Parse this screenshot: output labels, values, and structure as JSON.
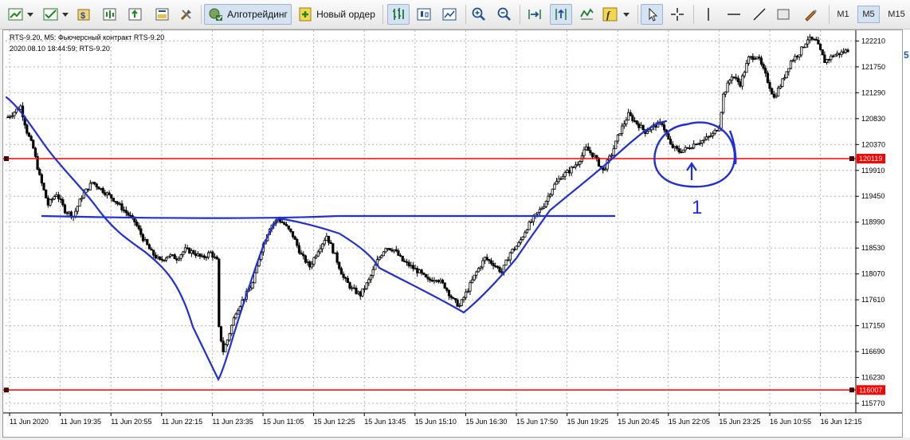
{
  "toolbar": {
    "algo_trading_label": "Алготрейдинг",
    "new_order_label": "Новый ордер",
    "timeframes": [
      {
        "label": "M1",
        "active": false
      },
      {
        "label": "M5",
        "active": true
      },
      {
        "label": "M15",
        "active": false
      }
    ]
  },
  "chart": {
    "header_title": "RTS-9.20, M5:  Фьючерсный контракт RTS-9.20",
    "header_info": "2020.08.10 18:44:59; RTS-9.20",
    "price_axis_labels": [
      "122210",
      "121750",
      "121290",
      "120830",
      "120370",
      "119910",
      "119450",
      "118990",
      "118530",
      "118070",
      "117610",
      "117150",
      "116690",
      "116230",
      "115770"
    ],
    "time_axis_labels": [
      "11 Jun 2020",
      "11 Jun 19:35",
      "11 Jun 20:55",
      "11 Jun 22:15",
      "11 Jun 23:35",
      "15 Jun 11:05",
      "15 Jun 12:25",
      "15 Jun 13:45",
      "15 Jun 15:10",
      "15 Jun 16:30",
      "15 Jun 17:50",
      "15 Jun 19:25",
      "15 Jun 20:45",
      "15 Jun 22:05",
      "15 Jun 23:25",
      "16 Jun 10:55",
      "16 Jun 12:15"
    ],
    "horizontal_levels": [
      {
        "price": 120119,
        "label": "120119",
        "color": "#ff0000"
      },
      {
        "price": 116007,
        "label": "116007",
        "color": "#ff0000"
      }
    ],
    "annotation_text": "1",
    "edge_label": "5",
    "colors": {
      "candle": "#000000",
      "drawing": "#1f2fd9",
      "level": "#ff0000",
      "grid": "#b4b4b4"
    }
  },
  "chart_data": {
    "type": "candlestick",
    "symbol": "RTS-9.20",
    "timeframe": "M5",
    "ylim": [
      115600,
      122400
    ],
    "close_path": [
      [
        0,
        120860
      ],
      [
        3,
        120950
      ],
      [
        6,
        121050
      ],
      [
        9,
        120600
      ],
      [
        12,
        120300
      ],
      [
        15,
        119800
      ],
      [
        19,
        119300
      ],
      [
        23,
        119500
      ],
      [
        27,
        119200
      ],
      [
        31,
        119100
      ],
      [
        35,
        119450
      ],
      [
        40,
        119700
      ],
      [
        45,
        119550
      ],
      [
        50,
        119400
      ],
      [
        55,
        119200
      ],
      [
        60,
        119000
      ],
      [
        64,
        118700
      ],
      [
        68,
        118450
      ],
      [
        72,
        118300
      ],
      [
        76,
        118400
      ],
      [
        80,
        118350
      ],
      [
        84,
        118500
      ],
      [
        88,
        118450
      ],
      [
        92,
        118350
      ],
      [
        96,
        118450
      ],
      [
        99,
        118300
      ],
      [
        100,
        117100
      ],
      [
        102,
        116700
      ],
      [
        104,
        116900
      ],
      [
        108,
        117400
      ],
      [
        112,
        117650
      ],
      [
        116,
        117900
      ],
      [
        120,
        118500
      ],
      [
        124,
        118900
      ],
      [
        128,
        119050
      ],
      [
        131,
        118950
      ],
      [
        135,
        118750
      ],
      [
        139,
        118400
      ],
      [
        143,
        118200
      ],
      [
        147,
        118500
      ],
      [
        151,
        118750
      ],
      [
        155,
        118400
      ],
      [
        159,
        118000
      ],
      [
        163,
        117800
      ],
      [
        167,
        117700
      ],
      [
        171,
        117950
      ],
      [
        175,
        118300
      ],
      [
        179,
        118550
      ],
      [
        183,
        118500
      ],
      [
        187,
        118300
      ],
      [
        191,
        118200
      ],
      [
        195,
        118100
      ],
      [
        199,
        117950
      ],
      [
        203,
        118000
      ],
      [
        207,
        117850
      ],
      [
        211,
        117600
      ],
      [
        214,
        117500
      ],
      [
        218,
        117800
      ],
      [
        222,
        118100
      ],
      [
        226,
        118350
      ],
      [
        230,
        118250
      ],
      [
        234,
        118100
      ],
      [
        238,
        118450
      ],
      [
        242,
        118600
      ],
      [
        246,
        118900
      ],
      [
        250,
        119100
      ],
      [
        254,
        119300
      ],
      [
        258,
        119600
      ],
      [
        262,
        119800
      ],
      [
        266,
        119900
      ],
      [
        270,
        120050
      ],
      [
        274,
        120300
      ],
      [
        278,
        120150
      ],
      [
        282,
        119900
      ],
      [
        286,
        120200
      ],
      [
        290,
        120600
      ],
      [
        294,
        120900
      ],
      [
        298,
        120750
      ],
      [
        302,
        120600
      ],
      [
        306,
        120700
      ],
      [
        310,
        120750
      ],
      [
        314,
        120350
      ],
      [
        318,
        120250
      ],
      [
        322,
        120300
      ],
      [
        326,
        120400
      ],
      [
        330,
        120450
      ],
      [
        334,
        120550
      ],
      [
        337,
        120700
      ],
      [
        339,
        121250
      ],
      [
        343,
        121600
      ],
      [
        347,
        121450
      ],
      [
        351,
        121900
      ],
      [
        355,
        121950
      ],
      [
        359,
        121600
      ],
      [
        363,
        121200
      ],
      [
        367,
        121500
      ],
      [
        371,
        121850
      ],
      [
        375,
        122000
      ],
      [
        379,
        122250
      ],
      [
        383,
        122200
      ],
      [
        387,
        121850
      ],
      [
        391,
        121950
      ],
      [
        395,
        122000
      ],
      [
        398,
        122050
      ]
    ]
  }
}
